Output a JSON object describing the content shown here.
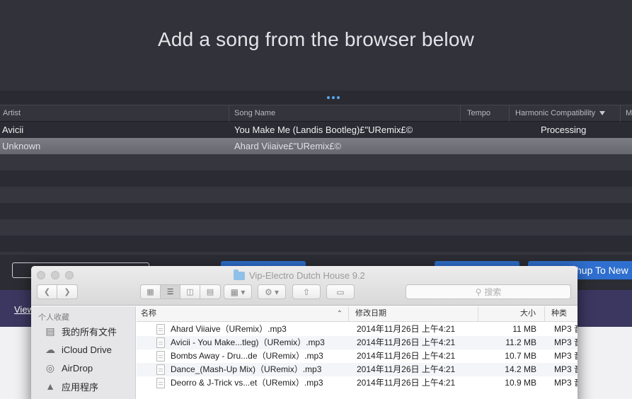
{
  "app": {
    "headline": "Add a song from the browser below",
    "table": {
      "columns": [
        "Artist",
        "Song Name",
        "Tempo",
        "Harmonic Compatibility",
        "M"
      ],
      "rows": [
        {
          "artist": "Avicii",
          "song": "You Make Me (Landis Bootleg)£\"URemix£©",
          "tempo": "",
          "harmonic": "Processing"
        },
        {
          "artist": "Unknown",
          "song": "Ahard Viiaive£\"URemix£©",
          "tempo": "",
          "harmonic": ""
        }
      ]
    },
    "mashup_button_label": "hup To New",
    "view_link": "View"
  },
  "finder": {
    "window_title": "Vip-Electro Dutch House 9.2",
    "search_placeholder": "搜索",
    "sidebar": {
      "section": "个人收藏",
      "items": [
        {
          "label": "我的所有文件",
          "icon": "all-files-icon"
        },
        {
          "label": "iCloud Drive",
          "icon": "cloud-icon"
        },
        {
          "label": "AirDrop",
          "icon": "airdrop-icon"
        },
        {
          "label": "应用程序",
          "icon": "applications-icon"
        }
      ]
    },
    "columns": {
      "name": "名称",
      "date": "修改日期",
      "size": "大小",
      "kind": "种类"
    },
    "files": [
      {
        "name": "Ahard Viiaive（URemix）.mp3",
        "date": "2014年11月26日 上午4:21",
        "size": "11 MB",
        "kind": "MP3 音"
      },
      {
        "name": "Avicii - You Make...tleg)（URemix）.mp3",
        "date": "2014年11月26日 上午4:21",
        "size": "11.2 MB",
        "kind": "MP3 音"
      },
      {
        "name": "Bombs Away - Dru...de（URemix）.mp3",
        "date": "2014年11月26日 上午4:21",
        "size": "10.7 MB",
        "kind": "MP3 音"
      },
      {
        "name": "Dance_(Mash-Up Mix)（URemix）.mp3",
        "date": "2014年11月26日 上午4:21",
        "size": "14.2 MB",
        "kind": "MP3 音"
      },
      {
        "name": "Deorro & J-Trick vs...et（URemix）.mp3",
        "date": "2014年11月26日 上午4:21",
        "size": "10.9 MB",
        "kind": "MP3 音"
      }
    ]
  },
  "colors": {
    "accent_blue": "#2f6fcf",
    "app_background": "#2f3038",
    "selected_row": "#6f7078",
    "purple_band": "#3c3760"
  }
}
